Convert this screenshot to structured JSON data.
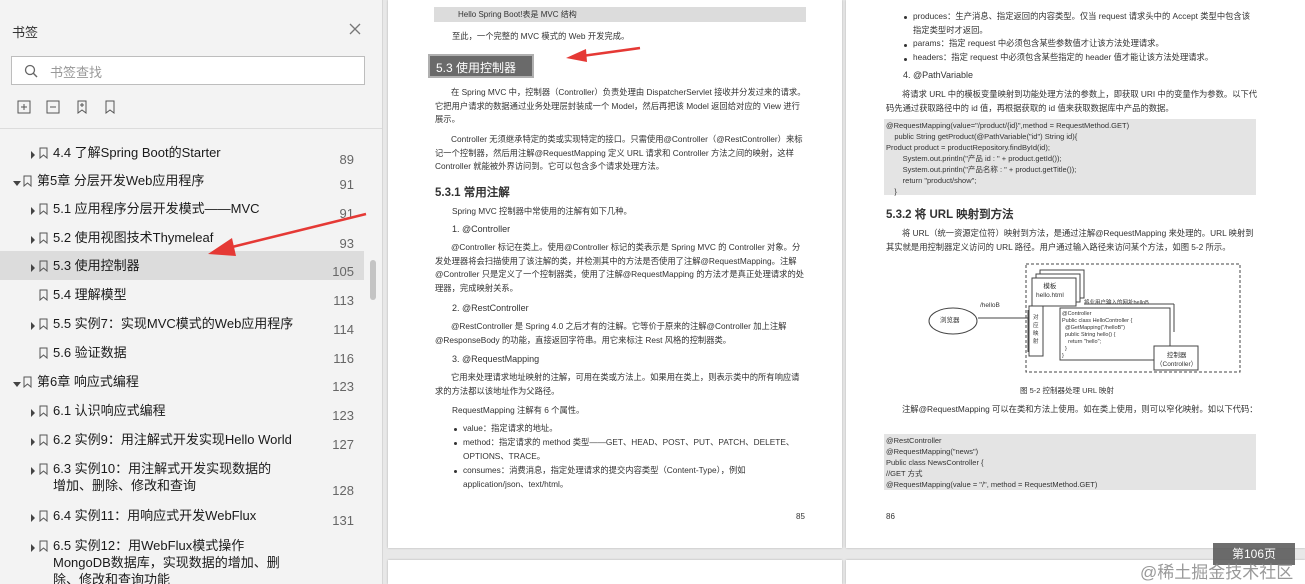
{
  "sidebar": {
    "title": "书签",
    "search_placeholder": "书签查找",
    "tools": [
      "expand-all-icon",
      "collapse-all-icon",
      "add-bookmark-icon",
      "bookmark-icon"
    ],
    "items": [
      {
        "label": "4.4 了解Spring Boot的Starter",
        "page": "89",
        "level": 1,
        "expandable": true,
        "expanded": false
      },
      {
        "label": "第5章 分层开发Web应用程序",
        "page": "91",
        "level": 0,
        "expandable": true,
        "expanded": true
      },
      {
        "label": "5.1 应用程序分层开发模式——MVC",
        "page": "91",
        "level": 1,
        "expandable": true,
        "expanded": false
      },
      {
        "label": "5.2 使用视图技术Thymeleaf",
        "page": "93",
        "level": 1,
        "expandable": true,
        "expanded": false
      },
      {
        "label": "5.3 使用控制器",
        "page": "105",
        "level": 1,
        "expandable": true,
        "expanded": false,
        "selected": true
      },
      {
        "label": "5.4 理解模型",
        "page": "113",
        "level": 1,
        "expandable": false
      },
      {
        "label": "5.5 实例7：实现MVC模式的Web应用程序",
        "page": "114",
        "level": 1,
        "expandable": true,
        "expanded": false
      },
      {
        "label": "5.6 验证数据",
        "page": "116",
        "level": 1,
        "expandable": false
      },
      {
        "label": "第6章 响应式编程",
        "page": "123",
        "level": 0,
        "expandable": true,
        "expanded": true
      },
      {
        "label": "6.1 认识响应式编程",
        "page": "123",
        "level": 1,
        "expandable": true,
        "expanded": false
      },
      {
        "label": "6.2 实例9：用注解式开发实现Hello World",
        "page": "127",
        "level": 1,
        "expandable": true,
        "expanded": false
      },
      {
        "label": "6.3 实例10：用注解式开发实现数据的增加、删除、修改和查询",
        "page": "128",
        "level": 1,
        "expandable": true,
        "expanded": false
      },
      {
        "label": "6.4 实例11：用响应式开发WebFlux",
        "page": "131",
        "level": 1,
        "expandable": true,
        "expanded": false
      },
      {
        "label": "6.5 实例12：用WebFlux模式操作MongoDB数据库，实现数据的增加、删除、修改和查询功能",
        "page": "",
        "level": 1,
        "expandable": true,
        "expanded": false
      }
    ]
  },
  "page_left": {
    "fig_caption": "Hello Spring Boot!表是 MVC 结构",
    "intro": "至此，一个完整的 MVC 模式的 Web 开发完成。",
    "section_title": "5.3   使用控制器",
    "para1": "在 Spring MVC 中，控制器（Controller）负责处理由 DispatcherServlet 接收并分发过来的请求。它把用户请求的数据通过业务处理层封装成一个 Model，然后再把该 Model 返回给对应的 View 进行展示。",
    "para2": "Controller 无须继承特定的类或实现特定的接口。只需使用@Controller（@RestController）来标记一个控制器，然后用注解@RequestMapping 定义 URL 请求和 Controller 方法之间的映射，这样 Controller 就能被外界访问到。它可以包含多个请求处理方法。",
    "sub_title": "5.3.1   常用注解",
    "para3": "Spring MVC 控制器中常使用的注解有如下几种。",
    "h_controller": "1.  @Controller",
    "para4": "@Controller 标记在类上。使用@Controller 标记的类表示是 Spring MVC 的 Controller 对象。分发处理器将会扫描使用了该注解的类，并检测其中的方法是否使用了注解@RequestMapping。注解@Controller 只是定义了一个控制器类，使用了注解@RequestMapping 的方法才是真正处理请求的处理器，完成映射关系。",
    "h_rest": "2.  @RestController",
    "para5": "@RestController 是 Spring 4.0 之后才有的注解。它等价于原来的注解@Controller 加上注解@ResponseBody 的功能，直接返回字符串。用它来标注 Rest 风格的控制器类。",
    "h_mapping": "3.  @RequestMapping",
    "para6": "它用来处理请求地址映射的注解，可用在类或方法上。如果用在类上，则表示类中的所有响应请求的方法都以该地址作为父路径。",
    "para7": "RequestMapping 注解有 6 个属性。",
    "bullets": [
      "value：指定请求的地址。",
      "method：指定请求的 method 类型——GET、HEAD、POST、PUT、PATCH、DELETE、OPTIONS、TRACE。",
      "consumes：消费消息，指定处理请求的提交内容类型（Content-Type），例如 application/json、text/html。"
    ],
    "page_number": "85"
  },
  "page_right": {
    "bullets": [
      "produces：生产消息、指定返回的内容类型。仅当 request 请求头中的 Accept 类型中包含该指定类型时才返回。",
      "params：指定 request 中必须包含某些参数值才让该方法处理请求。",
      "headers：指定 request 中必须包含某些指定的 header 值才能让该方法处理请求。"
    ],
    "h_path": "4.  @PathVariable",
    "para1": "将请求 URL 中的模板变量映射到功能处理方法的参数上，即获取 URI 中的变量作为参数。以下代码先通过获取路径中的 id 值，再根据获取的 id 值来获取数据库中产品的数据。",
    "code1": "@RequestMapping(value=\"/product/{id}\",method = RequestMethod.GET)\n    public String getProduct(@PathVariable(\"id\") String id){\nProduct product = productRepository.findById(id);\n        System.out.println(\"产品 id : \" + product.getId());\n        System.out.println(\"产品名称 : \" + product.getTitle());\n        return \"product/show\";\n    }",
    "sub_title": "5.3.2   将 URL 映射到方法",
    "para2": "将 URL（统一资源定位符）映射到方法，是通过注解@RequestMapping 来处理的。URL 映射到其实就是用控制器定义访问的 URL 路径。用户通过输入路径来访问某个方法，如图 5-2 所示。",
    "diagram": {
      "browser": "浏览器",
      "path": "/helloB",
      "template": "模板\nhello.html",
      "hint": "将业用户输入的网址helloB",
      "mapping": "对\n应\n映\n射",
      "code": "@Controller\nPublic class HelloController {\n  @GetMapping(\"/helloB\")\n  public String hello() {\n    return \"hello\";\n  }\n}",
      "controller": "控制器\n（Controller）"
    },
    "fig_caption": "图 5-2   控制器处理 URL 映射",
    "para3": "注解@RequestMapping 可以在类和方法上使用。如在类上使用，则可以窄化映射。如以下代码：",
    "code2": "@RestController\n@RequestMapping(\"news\")\nPublic class NewsController {\n//GET 方式\n@RequestMapping(value = \"/\", method = RequestMethod.GET)",
    "page_number": "86"
  },
  "viewer": {
    "page_indicator": "第106页",
    "watermark": "@稀土掘金技术社区"
  },
  "colors": {
    "arrow": "#e53935",
    "selected_row": "#dcdcdc"
  }
}
